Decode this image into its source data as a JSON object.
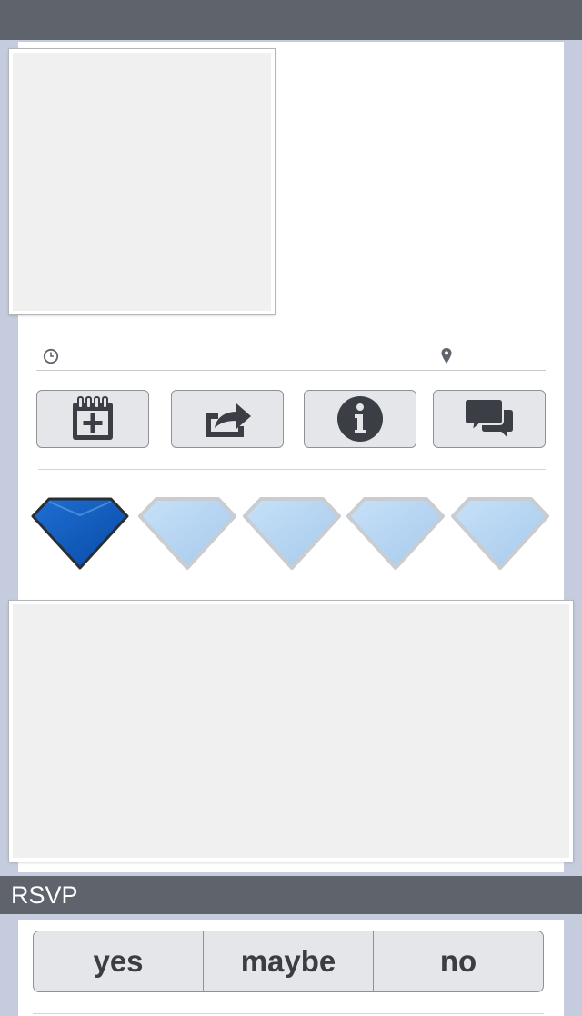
{
  "rsvp": {
    "title": "RSVP",
    "options": [
      "yes",
      "maybe",
      "no"
    ]
  },
  "event_meta": {
    "time_icon": "clock-icon",
    "location_icon": "map-pin-icon"
  },
  "actions": [
    {
      "icon": "add-to-calendar-icon"
    },
    {
      "icon": "share-icon"
    },
    {
      "icon": "info-icon"
    },
    {
      "icon": "comments-icon"
    }
  ],
  "rating": {
    "value": 1,
    "max": 5,
    "icon": "diamond-icon"
  },
  "colors": {
    "header": "#5f636c",
    "page_bg": "#c5ccdd",
    "diamond_active": "#0a58b8",
    "diamond_inactive": "#b4d4f1"
  }
}
